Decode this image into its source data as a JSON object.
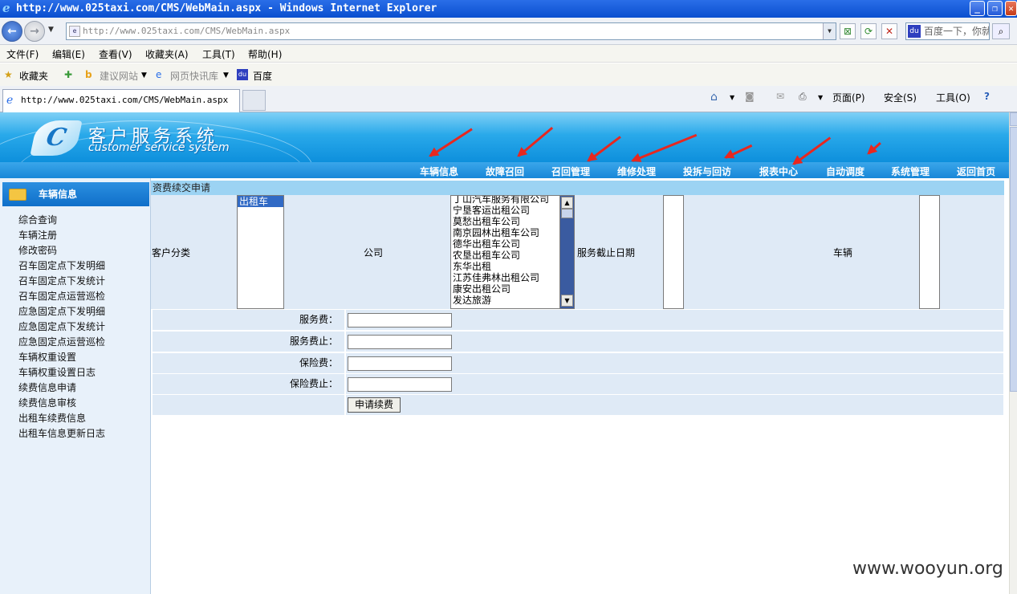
{
  "window": {
    "title": "http://www.025taxi.com/CMS/WebMain.aspx - Windows Internet Explorer",
    "minimize": "_",
    "maximize": "❐",
    "close": "✕"
  },
  "address": {
    "url": "http://www.025taxi.com/CMS/WebMain.aspx",
    "search_placeholder": "百度一下，你就"
  },
  "menu": [
    "文件(F)",
    "编辑(E)",
    "查看(V)",
    "收藏夹(A)",
    "工具(T)",
    "帮助(H)"
  ],
  "favorites": {
    "fav_label": "收藏夹",
    "suggested_sites": "建议网站",
    "web_slice": "网页快讯库",
    "baidu": "百度"
  },
  "tab": {
    "title": "http://www.025taxi.com/CMS/WebMain.aspx"
  },
  "commandbar": {
    "page": "页面(P)",
    "safety": "安全(S)",
    "tools": "工具(O)"
  },
  "site": {
    "logo_cn": "客户服务系统",
    "logo_en": "customer service system",
    "nav": [
      "车辆信息",
      "故障召回",
      "召回管理",
      "维修处理",
      "投拆与回访",
      "报表中心",
      "自动调度",
      "系统管理",
      "返回首页"
    ]
  },
  "sidebar": {
    "heading": "车辆信息",
    "items": [
      "综合查询",
      "车辆注册",
      "修改密码",
      "召车固定点下发明细",
      "召车固定点下发统计",
      "召车固定点运营巡检",
      "应急固定点下发明细",
      "应急固定点下发统计",
      "应急固定点运营巡检",
      "车辆权重设置",
      "车辆权重设置日志",
      "续费信息申请",
      "续费信息审核",
      "出租车续费信息",
      "出租车信息更新日志"
    ]
  },
  "main": {
    "breadcrumb": "资费续交申请",
    "customer_type_label": "客户分类",
    "customer_types": [
      "出租车"
    ],
    "company_label": "公司",
    "companies": [
      "丁山汽车服务有限公司",
      "宁垦客运出租公司",
      "莫愁出租车公司",
      "南京园林出租车公司",
      "德华出租车公司",
      "农垦出租车公司",
      "东华出租",
      "江苏佳弗林出租公司",
      "康安出租公司",
      "发达旅游"
    ],
    "service_end_label": "服务截止日期",
    "vehicle_label": "车辆",
    "fields": [
      {
        "label": "服务费：",
        "value": ""
      },
      {
        "label": "服务费止：",
        "value": ""
      },
      {
        "label": "保险费：",
        "value": ""
      },
      {
        "label": "保险费止：",
        "value": ""
      }
    ],
    "submit_label": "申请续费"
  },
  "watermark": "www.wooyun.org"
}
